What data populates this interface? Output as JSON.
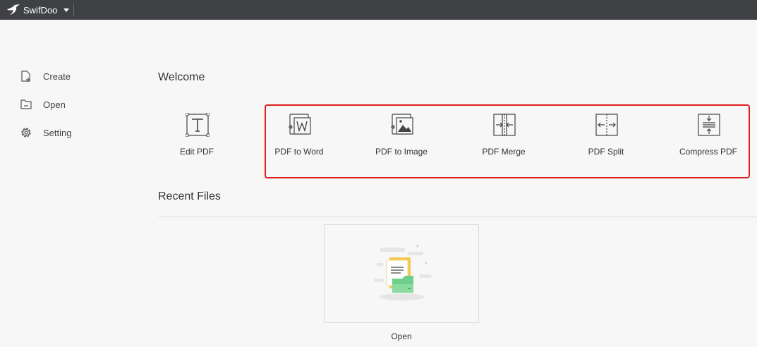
{
  "titlebar": {
    "app_name": "SwifDoo",
    "logo_icon": "swift-bird-icon",
    "menu_icon": "caret-down-icon"
  },
  "sidebar": {
    "items": [
      {
        "label": "Create",
        "icon": "create-file-icon"
      },
      {
        "label": "Open",
        "icon": "folder-open-icon"
      },
      {
        "label": "Setting",
        "icon": "gear-icon"
      }
    ]
  },
  "welcome": {
    "title": "Welcome",
    "tools": [
      {
        "label": "Edit PDF",
        "icon": "text-edit-icon"
      },
      {
        "label": "PDF to Word",
        "icon": "pdf-to-word-icon"
      },
      {
        "label": "PDF to Image",
        "icon": "pdf-to-image-icon"
      },
      {
        "label": "PDF Merge",
        "icon": "merge-icon"
      },
      {
        "label": "PDF Split",
        "icon": "split-icon"
      },
      {
        "label": "Compress PDF",
        "icon": "compress-icon"
      }
    ],
    "highlight_color": "#e02020"
  },
  "recent": {
    "title": "Recent Files",
    "open_label": "Open",
    "open_icon": "open-folder-illustration"
  },
  "colors": {
    "titlebar_bg": "#3f4144",
    "page_bg": "#f7f7f7",
    "illustration_yellow": "#f5c74e",
    "illustration_green": "#6fcf8a"
  }
}
